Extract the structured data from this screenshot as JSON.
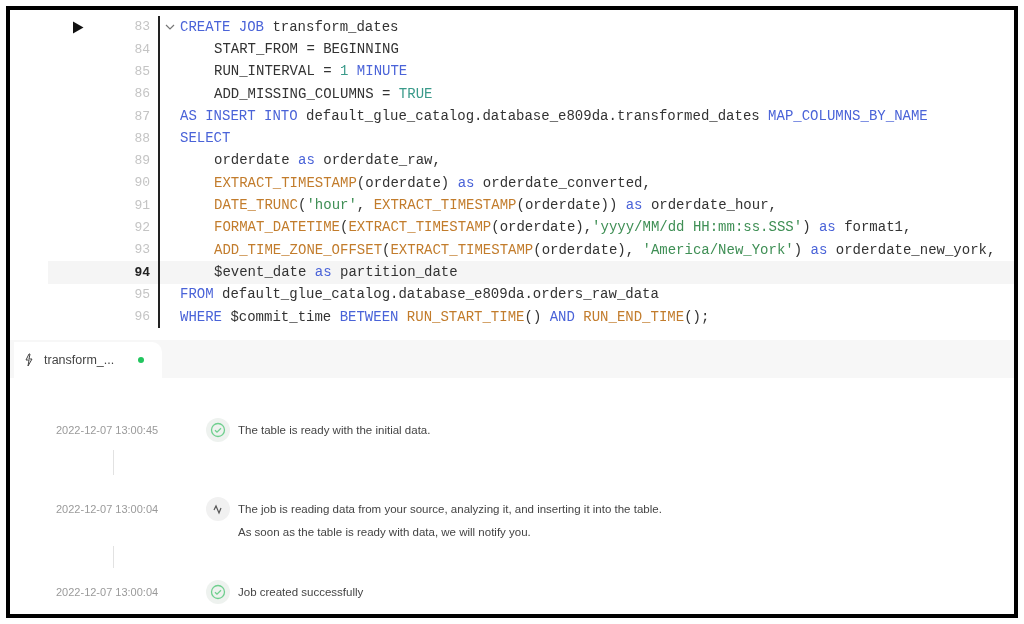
{
  "editor": {
    "lines": [
      {
        "number": "83",
        "run_button": true,
        "foldable": true,
        "current": false,
        "indented": false,
        "tokens": [
          {
            "t": "CREATE JOB",
            "kind": "kw"
          },
          {
            "t": " transform_dates",
            "kind": "plain"
          }
        ]
      },
      {
        "number": "84",
        "run_button": false,
        "foldable": false,
        "current": false,
        "indented": true,
        "tokens": [
          {
            "t": "START_FROM = BEGINNING",
            "kind": "plain"
          }
        ]
      },
      {
        "number": "85",
        "run_button": false,
        "foldable": false,
        "current": false,
        "indented": true,
        "tokens": [
          {
            "t": "RUN_INTERVAL = ",
            "kind": "plain"
          },
          {
            "t": "1",
            "kind": "num"
          },
          {
            "t": " MINUTE",
            "kind": "kw"
          }
        ]
      },
      {
        "number": "86",
        "run_button": false,
        "foldable": false,
        "current": false,
        "indented": true,
        "tokens": [
          {
            "t": "ADD_MISSING_COLUMNS = ",
            "kind": "plain"
          },
          {
            "t": "TRUE",
            "kind": "num"
          }
        ]
      },
      {
        "number": "87",
        "run_button": false,
        "foldable": false,
        "current": false,
        "indented": false,
        "tokens": [
          {
            "t": "AS INSERT INTO",
            "kind": "kw"
          },
          {
            "t": " default_glue_catalog.database_e809da.transformed_dates ",
            "kind": "plain"
          },
          {
            "t": "MAP_COLUMNS_BY_NAME",
            "kind": "kw"
          }
        ]
      },
      {
        "number": "88",
        "run_button": false,
        "foldable": false,
        "current": false,
        "indented": false,
        "tokens": [
          {
            "t": "SELECT",
            "kind": "kw"
          }
        ]
      },
      {
        "number": "89",
        "run_button": false,
        "foldable": false,
        "current": false,
        "indented": true,
        "tokens": [
          {
            "t": "orderdate ",
            "kind": "plain"
          },
          {
            "t": "as",
            "kind": "kw"
          },
          {
            "t": " orderdate_raw,",
            "kind": "plain"
          }
        ]
      },
      {
        "number": "90",
        "run_button": false,
        "foldable": false,
        "current": false,
        "indented": true,
        "tokens": [
          {
            "t": "EXTRACT_TIMESTAMP",
            "kind": "fn"
          },
          {
            "t": "(orderdate) ",
            "kind": "plain"
          },
          {
            "t": "as",
            "kind": "kw"
          },
          {
            "t": " orderdate_converted,",
            "kind": "plain"
          }
        ]
      },
      {
        "number": "91",
        "run_button": false,
        "foldable": false,
        "current": false,
        "indented": true,
        "tokens": [
          {
            "t": "DATE_TRUNC",
            "kind": "fn"
          },
          {
            "t": "(",
            "kind": "plain"
          },
          {
            "t": "'hour'",
            "kind": "str"
          },
          {
            "t": ", ",
            "kind": "plain"
          },
          {
            "t": "EXTRACT_TIMESTAMP",
            "kind": "fn"
          },
          {
            "t": "(orderdate)) ",
            "kind": "plain"
          },
          {
            "t": "as",
            "kind": "kw"
          },
          {
            "t": " orderdate_hour,",
            "kind": "plain"
          }
        ]
      },
      {
        "number": "92",
        "run_button": false,
        "foldable": false,
        "current": false,
        "indented": true,
        "tokens": [
          {
            "t": "FORMAT_DATETIME",
            "kind": "fn"
          },
          {
            "t": "(",
            "kind": "plain"
          },
          {
            "t": "EXTRACT_TIMESTAMP",
            "kind": "fn"
          },
          {
            "t": "(orderdate),",
            "kind": "plain"
          },
          {
            "t": "'yyyy/MM/dd HH:mm:ss.SSS'",
            "kind": "str"
          },
          {
            "t": ") ",
            "kind": "plain"
          },
          {
            "t": "as",
            "kind": "kw"
          },
          {
            "t": " format1,",
            "kind": "plain"
          }
        ]
      },
      {
        "number": "93",
        "run_button": false,
        "foldable": false,
        "current": false,
        "indented": true,
        "tokens": [
          {
            "t": "ADD_TIME_ZONE_OFFSET",
            "kind": "fn"
          },
          {
            "t": "(",
            "kind": "plain"
          },
          {
            "t": "EXTRACT_TIMESTAMP",
            "kind": "fn"
          },
          {
            "t": "(orderdate), ",
            "kind": "plain"
          },
          {
            "t": "'America/New_York'",
            "kind": "str"
          },
          {
            "t": ") ",
            "kind": "plain"
          },
          {
            "t": "as",
            "kind": "kw"
          },
          {
            "t": " orderdate_new_york,",
            "kind": "plain"
          }
        ]
      },
      {
        "number": "94",
        "run_button": false,
        "foldable": false,
        "current": true,
        "indented": true,
        "tokens": [
          {
            "t": "$event_date ",
            "kind": "plain"
          },
          {
            "t": "as",
            "kind": "kw"
          },
          {
            "t": " partition_date",
            "kind": "plain"
          }
        ]
      },
      {
        "number": "95",
        "run_button": false,
        "foldable": false,
        "current": false,
        "indented": false,
        "tokens": [
          {
            "t": "FROM",
            "kind": "kw"
          },
          {
            "t": " default_glue_catalog.database_e809da.orders_raw_data",
            "kind": "plain"
          }
        ]
      },
      {
        "number": "96",
        "run_button": false,
        "foldable": false,
        "current": false,
        "indented": false,
        "tokens": [
          {
            "t": "WHERE",
            "kind": "kw"
          },
          {
            "t": " $commit_time ",
            "kind": "plain"
          },
          {
            "t": "BETWEEN ",
            "kind": "kw"
          },
          {
            "t": "RUN_START_TIME",
            "kind": "fn"
          },
          {
            "t": "() ",
            "kind": "plain"
          },
          {
            "t": "AND ",
            "kind": "kw"
          },
          {
            "t": "RUN_END_TIME",
            "kind": "fn"
          },
          {
            "t": "();",
            "kind": "plain"
          }
        ]
      }
    ]
  },
  "tab": {
    "label": "transform_...",
    "running": true
  },
  "events": [
    {
      "time": "2022-12-07 13:00:45",
      "kind": "success",
      "lines": [
        "The table is ready with the initial data."
      ]
    },
    {
      "time": "2022-12-07 13:00:04",
      "kind": "activity",
      "lines": [
        "The job is reading data from your source, analyzing it, and inserting it into the table.",
        "As soon as the table is ready with data, we will notify you."
      ]
    },
    {
      "time": "2022-12-07 13:00:04",
      "kind": "success",
      "lines": [
        "Job created successfully"
      ]
    }
  ]
}
